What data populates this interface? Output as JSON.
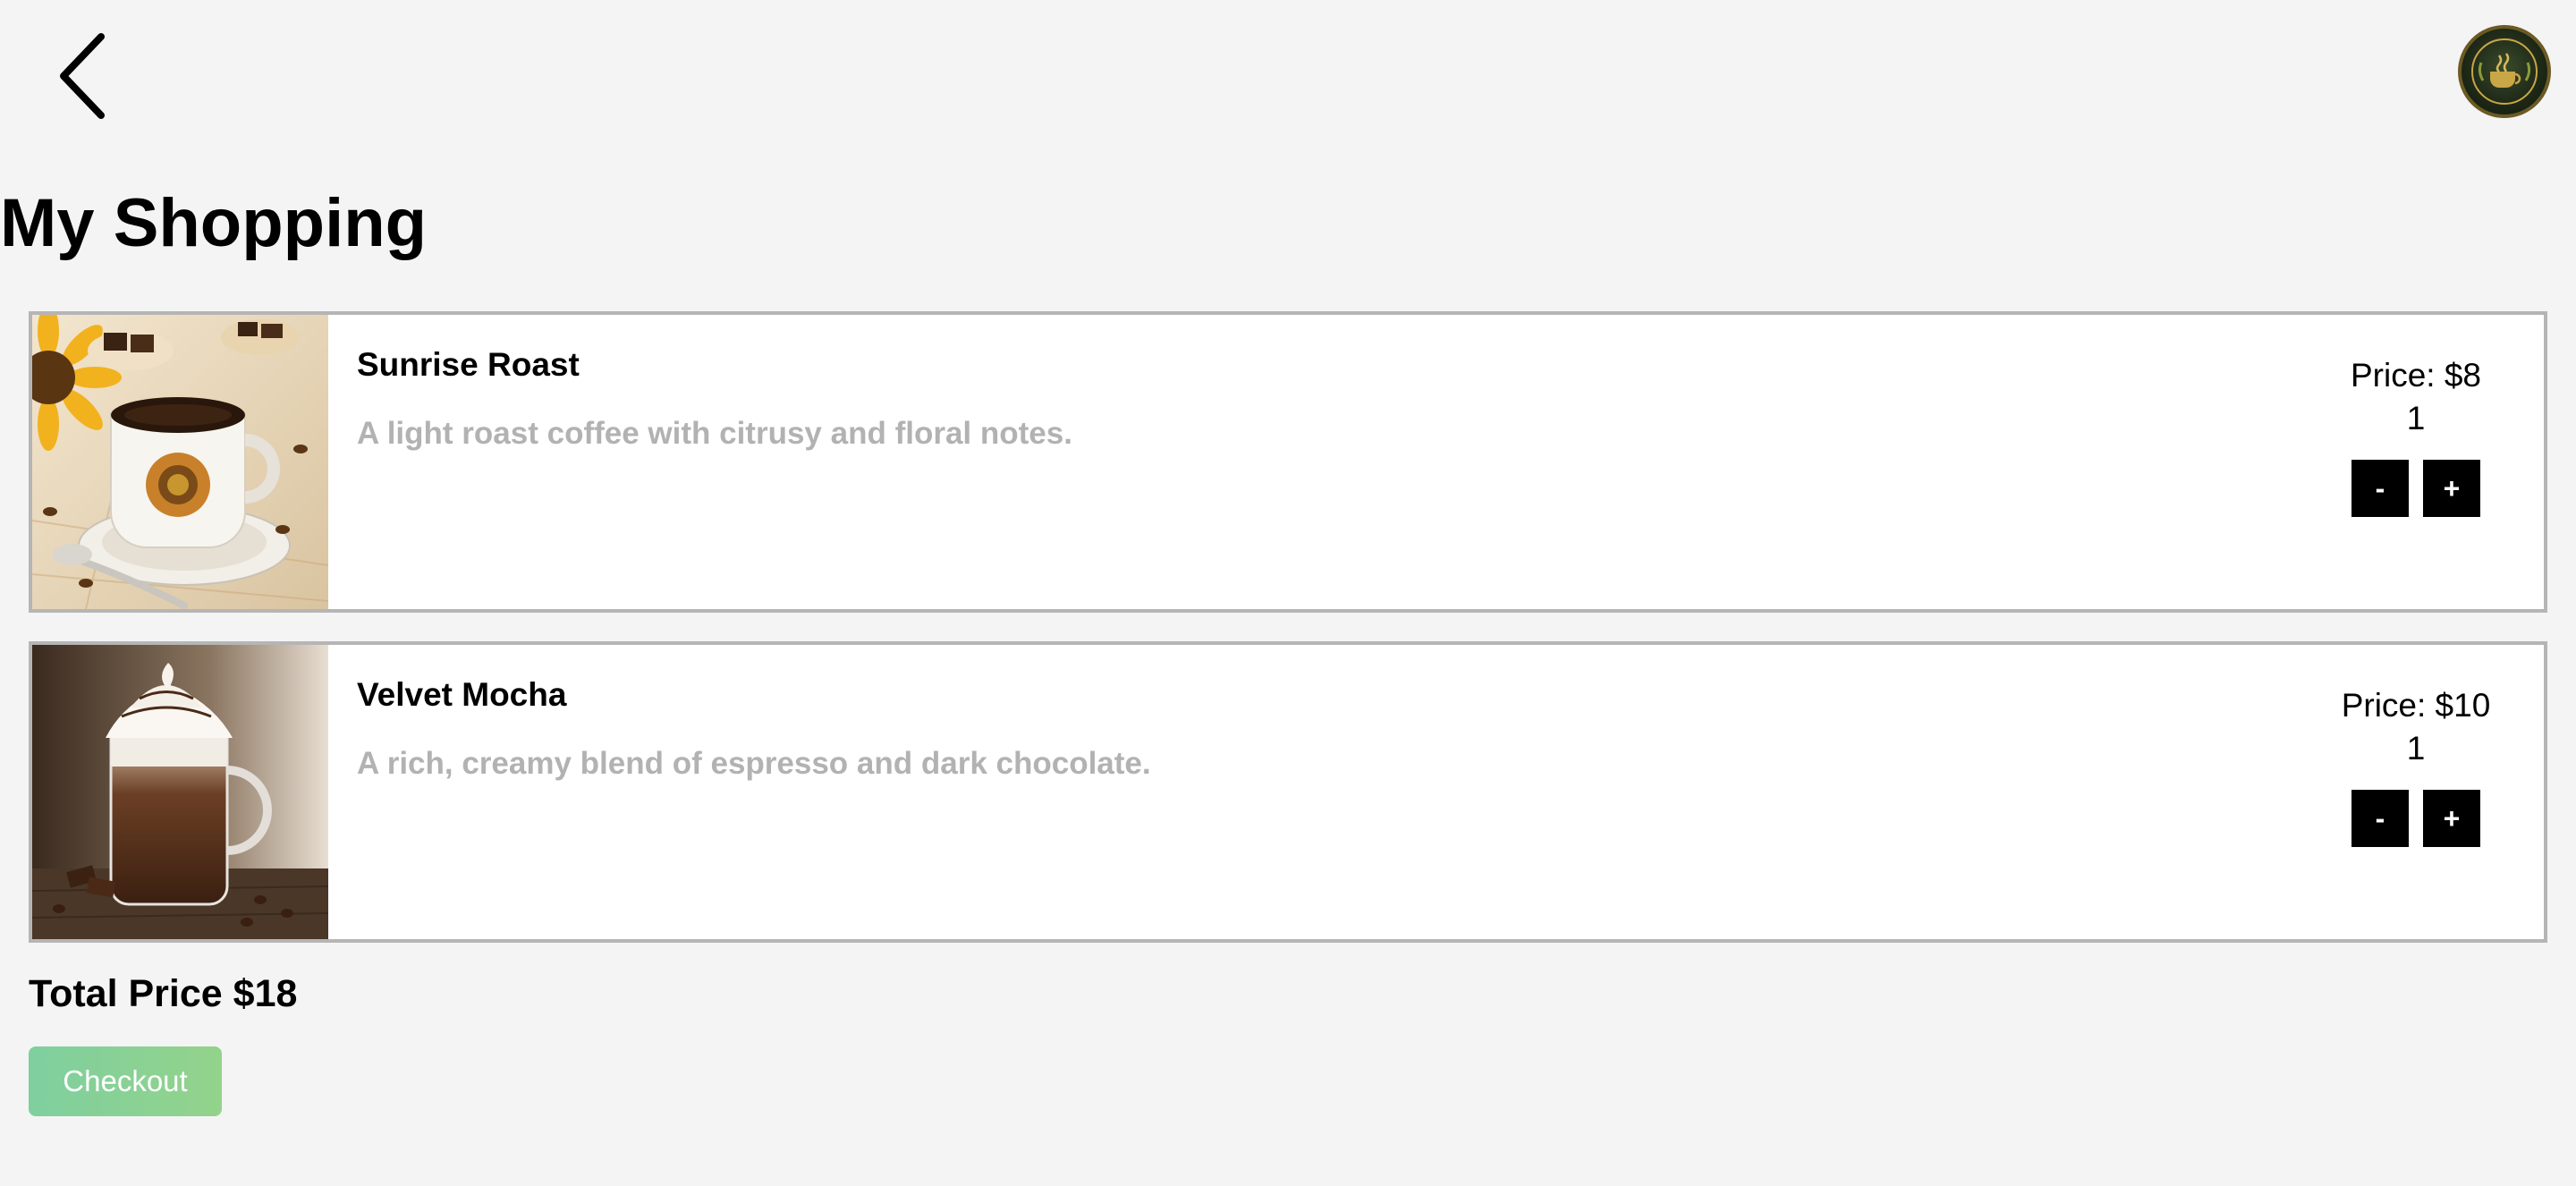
{
  "header": {
    "back_icon": "chevron-left-icon",
    "logo_icon": "coffee-logo-icon"
  },
  "page_title": "My Shopping",
  "cart": {
    "items": [
      {
        "name": "Sunrise Roast",
        "description": "A light roast coffee with citrusy and floral notes.",
        "price_label": "Price: $8",
        "quantity": "1",
        "decrement_label": "-",
        "increment_label": "+"
      },
      {
        "name": "Velvet Mocha",
        "description": "A rich, creamy blend of espresso and dark chocolate.",
        "price_label": "Price: $10",
        "quantity": "1",
        "decrement_label": "-",
        "increment_label": "+"
      }
    ]
  },
  "total": {
    "label": "Total Price",
    "value": "$18"
  },
  "checkout": {
    "label": "Checkout"
  },
  "colors": {
    "background": "#f4f4f4",
    "description_text": "#b2b2b2",
    "item_border": "#b5b5b5",
    "checkout_gradient_start": "#7fcf9f",
    "checkout_gradient_end": "#93d38b"
  }
}
